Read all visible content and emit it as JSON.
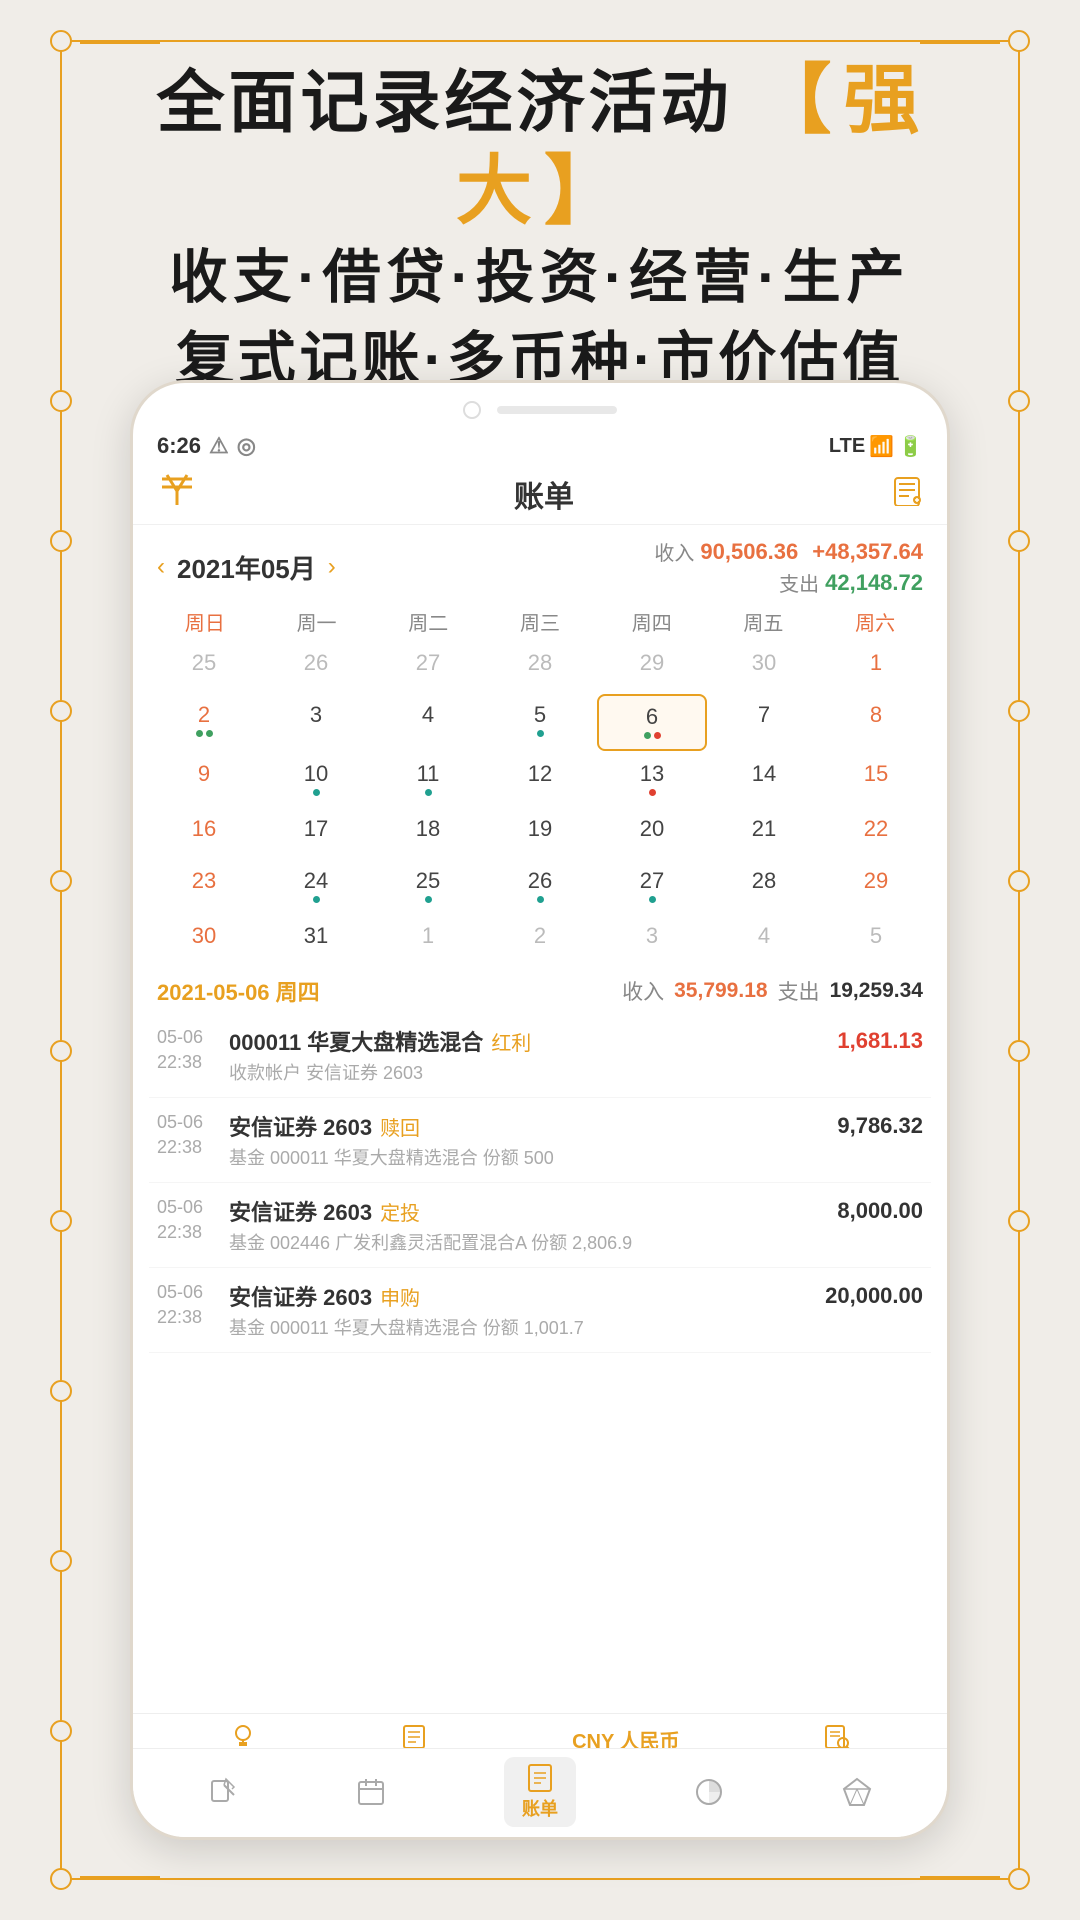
{
  "background_color": "#f0ede8",
  "header": {
    "line1_part1": "全面记录经济活动",
    "line1_highlight": "强大",
    "line1_bracket_open": "【",
    "line1_bracket_close": "】",
    "line2": "收支·借贷·投资·经营·生产",
    "line3": "复式记账·多币种·市价估值"
  },
  "phone": {
    "status_bar": {
      "time": "6:26",
      "network": "LTE"
    },
    "app_header": {
      "title": "账单",
      "logo": "¥"
    },
    "calendar": {
      "month_display": "2021年05月",
      "income_label": "收入",
      "income_value": "90,506.36",
      "expense_label": "支出",
      "expense_value": "42,148.72",
      "net_value": "+48,357.64",
      "weekdays": [
        "周日",
        "周一",
        "周二",
        "周三",
        "周四",
        "周五",
        "周六"
      ],
      "days": [
        {
          "num": "25",
          "type": "prev"
        },
        {
          "num": "26",
          "type": "prev"
        },
        {
          "num": "27",
          "type": "prev"
        },
        {
          "num": "28",
          "type": "prev"
        },
        {
          "num": "29",
          "type": "prev"
        },
        {
          "num": "30",
          "type": "prev"
        },
        {
          "num": "1",
          "type": "normal"
        },
        {
          "num": "2",
          "type": "normal",
          "dots": [
            "green",
            "green"
          ]
        },
        {
          "num": "3",
          "type": "normal"
        },
        {
          "num": "4",
          "type": "normal"
        },
        {
          "num": "5",
          "type": "normal",
          "dots": [
            "teal"
          ]
        },
        {
          "num": "6",
          "type": "today",
          "dots": [
            "green",
            "red"
          ]
        },
        {
          "num": "7",
          "type": "normal"
        },
        {
          "num": "8",
          "type": "normal"
        },
        {
          "num": "9",
          "type": "normal"
        },
        {
          "num": "10",
          "type": "normal",
          "dots": [
            "teal"
          ]
        },
        {
          "num": "11",
          "type": "normal",
          "dots": [
            "teal"
          ]
        },
        {
          "num": "12",
          "type": "normal"
        },
        {
          "num": "13",
          "type": "normal",
          "dots": [
            "red"
          ]
        },
        {
          "num": "14",
          "type": "normal"
        },
        {
          "num": "15",
          "type": "normal"
        },
        {
          "num": "16",
          "type": "normal"
        },
        {
          "num": "17",
          "type": "normal"
        },
        {
          "num": "18",
          "type": "normal"
        },
        {
          "num": "19",
          "type": "normal"
        },
        {
          "num": "20",
          "type": "normal"
        },
        {
          "num": "21",
          "type": "normal"
        },
        {
          "num": "22",
          "type": "normal"
        },
        {
          "num": "23",
          "type": "normal"
        },
        {
          "num": "24",
          "type": "normal",
          "dots": [
            "teal"
          ]
        },
        {
          "num": "25",
          "type": "normal",
          "dots": [
            "teal"
          ]
        },
        {
          "num": "26",
          "type": "normal",
          "dots": [
            "teal"
          ]
        },
        {
          "num": "27",
          "type": "normal",
          "dots": [
            "teal"
          ]
        },
        {
          "num": "28",
          "type": "normal"
        },
        {
          "num": "29",
          "type": "normal"
        },
        {
          "num": "30",
          "type": "normal"
        },
        {
          "num": "31",
          "type": "normal"
        },
        {
          "num": "1",
          "type": "next"
        },
        {
          "num": "2",
          "type": "next"
        },
        {
          "num": "3",
          "type": "next"
        },
        {
          "num": "4",
          "type": "next"
        },
        {
          "num": "5",
          "type": "next"
        }
      ]
    },
    "daily_summary": {
      "date": "2021-05-06 周四",
      "income_label": "收入",
      "income_value": "35,799.18",
      "expense_label": "支出",
      "expense_value": "19,259.34"
    },
    "transactions": [
      {
        "date": "05-06",
        "time": "22:38",
        "name": "000011 华夏大盘精选混合",
        "type": "红利",
        "sub": "收款帐户 安信证券 2603",
        "amount": "1,681.13",
        "amount_color": "red"
      },
      {
        "date": "05-06",
        "time": "22:38",
        "name": "安信证券 2603",
        "type": "赎回",
        "sub": "基金 000011 华夏大盘精选混合 份额 500",
        "amount": "9,786.32",
        "amount_color": "black"
      },
      {
        "date": "05-06",
        "time": "22:38",
        "name": "安信证券 2603",
        "type": "定投",
        "sub": "基金 002446 广发利鑫灵活配置混合A 份额 2,806.9",
        "amount": "8,000.00",
        "amount_color": "black"
      },
      {
        "date": "05-06",
        "time": "22:38",
        "name": "安信证券 2603",
        "type": "申购",
        "sub": "基金 000011 华夏大盘精选混合 份额 1,001.7",
        "amount": "20,000.00",
        "amount_color": "black"
      }
    ],
    "bottom_icons": [
      {
        "symbol": "💡",
        "label": ""
      },
      {
        "symbol": "📋",
        "label": ""
      },
      {
        "symbol": "CNY 人民币",
        "label": "",
        "active": true
      },
      {
        "symbol": "🔍",
        "label": ""
      }
    ],
    "bottom_nav": [
      {
        "symbol": "✏️",
        "label": ""
      },
      {
        "symbol": "📅",
        "label": ""
      },
      {
        "symbol": "📋",
        "label": "账单",
        "active": true
      },
      {
        "symbol": "📊",
        "label": ""
      },
      {
        "symbol": "💎",
        "label": ""
      }
    ]
  }
}
